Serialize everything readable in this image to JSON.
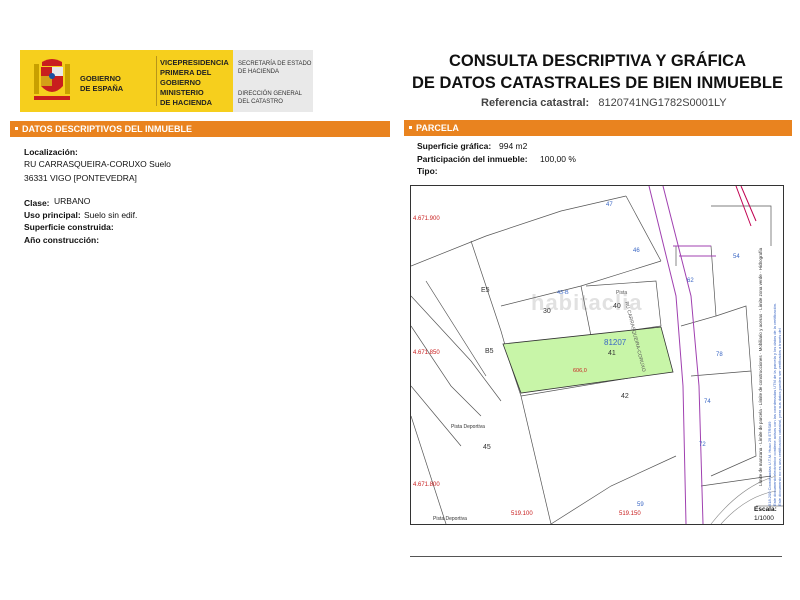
{
  "header": {
    "gobierno": [
      "GOBIERNO",
      "DE ESPAÑA"
    ],
    "vicepresidencia": [
      "VICEPRESIDENCIA",
      "PRIMERA DEL GOBIERNO"
    ],
    "ministerio": [
      "MINISTERIO",
      "DE HACIENDA"
    ],
    "secretaria": [
      "SECRETARÍA DE ESTADO",
      "DE HACIENDA"
    ],
    "direccion": [
      "DIRECCIÓN GENERAL",
      "DEL CATASTRO"
    ],
    "title_line1": "CONSULTA DESCRIPTIVA Y GRÁFICA",
    "title_line2": "DE DATOS CATASTRALES DE BIEN INMUEBLE",
    "ref_label": "Referencia catastral:",
    "ref_value": "8120741NG1782S0001LY"
  },
  "left": {
    "bar_title": "DATOS DESCRIPTIVOS DEL INMUEBLE",
    "localizacion_label": "Localización:",
    "localizacion_line1": "RU CARRASQUEIRA-CORUXO  Suelo",
    "localizacion_line2": "36331 VIGO [PONTEVEDRA]",
    "clase_label": "Clase:",
    "clase_value": "URBANO",
    "uso_label": "Uso principal:",
    "uso_value": "Suelo sin edif.",
    "superficie_label": "Superficie construida:",
    "ano_label": "Año construcción:"
  },
  "right": {
    "bar_title": "PARCELA",
    "superficie_label": "Superficie gráfica:",
    "superficie_value": "994 m2",
    "participacion_label": "Participación del inmueble:",
    "participacion_value": "100,00 %",
    "tipo_label": "Tipo:"
  },
  "map": {
    "y_coords": [
      "4.671.900",
      "4.671.850",
      "4.671.800"
    ],
    "x_coords": [
      "519.100",
      "519.150"
    ],
    "parcel_numbers": [
      "E5",
      "30",
      "40",
      "B5",
      "41",
      "42",
      "45",
      "46",
      "47",
      "43-B",
      "54",
      "62",
      "78",
      "74",
      "72",
      "59"
    ],
    "selected_parcel": "81207",
    "selected_parcel_label": "41",
    "road_name": "RU CARRASQUEIRA-CORUXO",
    "pista_deportiva": "Pista Deportiva",
    "pista": "Pista",
    "escala_label": "Escala:",
    "escala_value": "1/1000",
    "watermark": "habitaclia",
    "legend": [
      "Límite de manzana",
      "Límite de parcela",
      "Límite de construcciones",
      "Mobiliario y aceras",
      "Límite zona verde",
      "Hidrografía"
    ],
    "notes": [
      "518.200 Coordenadas U.T.M. Huso 29 ETRS89",
      "Este documento electrónico contiene avisos con las coordenadas UTM de la parcela y los datos de la certificación.",
      "Este documento no es una certificación catastral, pero sus datos pueden ser verificados a través del"
    ]
  },
  "colors": {
    "orange": "#e9831f",
    "yellow": "#f6cf1d",
    "parcel_green": "#c8f5a8",
    "road_purple": "#a040b0"
  }
}
